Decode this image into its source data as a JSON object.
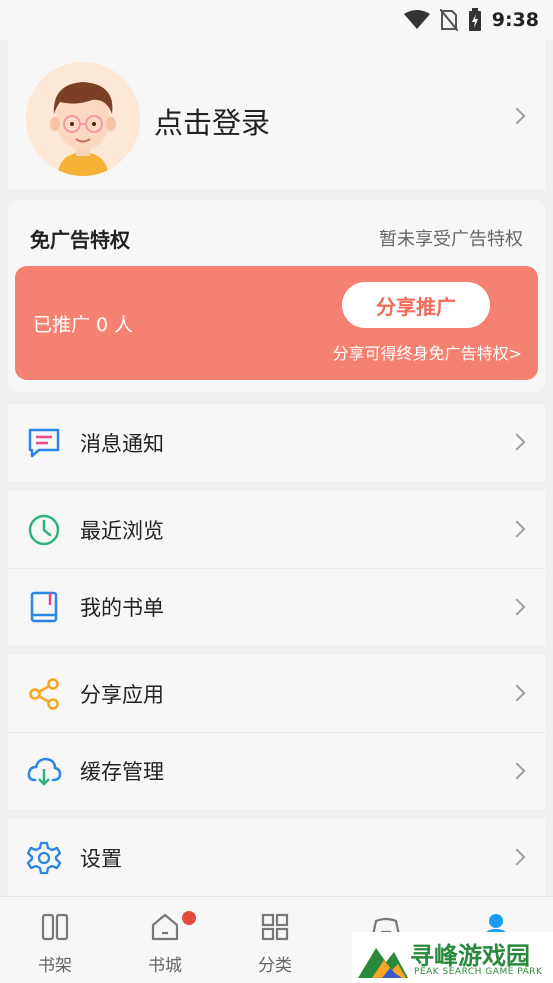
{
  "status_bar": {
    "time": "9:38",
    "icons": [
      "wifi-icon",
      "no-sim-icon",
      "battery-charging-icon"
    ]
  },
  "profile": {
    "login_text": "点击登录",
    "avatar": "cartoon-boy-avatar"
  },
  "ad_free": {
    "title": "免广告特权",
    "status": "暂未享受广告特权",
    "promoted_count": "已推广 0 人",
    "share_button": "分享推广",
    "note": "分享可得终身免广告特权>"
  },
  "menu": {
    "messages": "消息通知",
    "recent": "最近浏览",
    "booklist": "我的书单",
    "share_app": "分享应用",
    "cache": "缓存管理",
    "settings": "设置"
  },
  "tabs": [
    {
      "label": "书架",
      "icon": "bookshelf-icon"
    },
    {
      "label": "书城",
      "icon": "home-icon"
    },
    {
      "label": "分类",
      "icon": "grid-icon"
    },
    {
      "label": "",
      "icon": "game-icon"
    },
    {
      "label": "",
      "icon": "profile-icon"
    }
  ],
  "watermark": {
    "title": "寻峰游戏园",
    "subtitle": "PEAK SEARCH GAME PARK"
  },
  "colors": {
    "accent": "#f58173",
    "share_text": "#f26a58",
    "blue": "#2d86e6",
    "green": "#2fb37a",
    "orange": "#f5a623"
  }
}
